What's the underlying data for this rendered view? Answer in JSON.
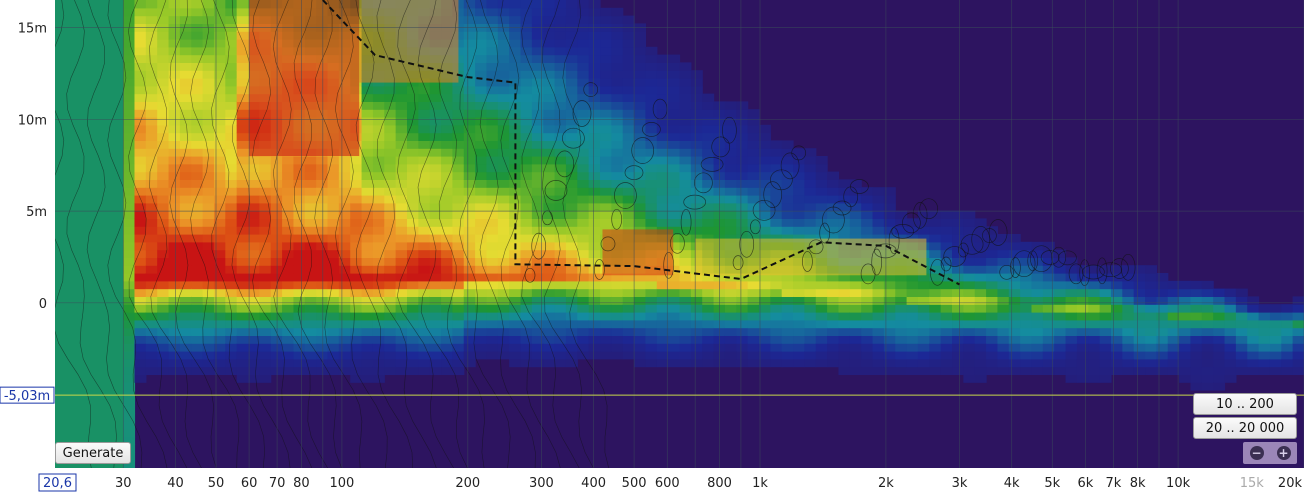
{
  "chart_data": {
    "type": "heatmap",
    "x_scale": "log",
    "xlim": [
      20.6,
      20000
    ],
    "ylim": [
      -9.0,
      16.5
    ],
    "x_ticks": [
      {
        "value": 30,
        "label": "30"
      },
      {
        "value": 40,
        "label": "40"
      },
      {
        "value": 50,
        "label": "50"
      },
      {
        "value": 60,
        "label": "60"
      },
      {
        "value": 70,
        "label": "70"
      },
      {
        "value": 80,
        "label": "80"
      },
      {
        "value": 100,
        "label": "100"
      },
      {
        "value": 200,
        "label": "200"
      },
      {
        "value": 300,
        "label": "300"
      },
      {
        "value": 400,
        "label": "400"
      },
      {
        "value": 500,
        "label": "500"
      },
      {
        "value": 600,
        "label": "600"
      },
      {
        "value": 800,
        "label": "800"
      },
      {
        "value": 1000,
        "label": "1k"
      },
      {
        "value": 2000,
        "label": "2k"
      },
      {
        "value": 3000,
        "label": "3k"
      },
      {
        "value": 4000,
        "label": "4k"
      },
      {
        "value": 5000,
        "label": "5k"
      },
      {
        "value": 6000,
        "label": "6k"
      },
      {
        "value": 7000,
        "label": "7k"
      },
      {
        "value": 8000,
        "label": "8k"
      },
      {
        "value": 10000,
        "label": "10k"
      },
      {
        "value": 15000,
        "label": "15k",
        "muted": true
      },
      {
        "value": 20000,
        "label": "20k"
      }
    ],
    "y_ticks": [
      {
        "value": 15,
        "label": "15m"
      },
      {
        "value": 10,
        "label": "10m"
      },
      {
        "value": 5,
        "label": "5m"
      },
      {
        "value": 0,
        "label": "0"
      }
    ],
    "x_cursor": {
      "value": 20.6,
      "label": "20,6"
    },
    "y_cursor": {
      "value": -5.03,
      "label": "-5,03m"
    },
    "colors": {
      "plot_background": "#2d1460",
      "low_band": "#1e8a2a",
      "grid": "#3a4a5a",
      "cursor_line": "#c8d84a",
      "contour": "#111111"
    },
    "regions": [
      {
        "freq": [
          20.6,
          30
        ],
        "time": [
          -9,
          16.5
        ],
        "value": 0.33
      },
      {
        "freq": [
          60,
          110
        ],
        "time": [
          8,
          16.5
        ],
        "value": 1.0
      },
      {
        "freq": [
          110,
          190
        ],
        "time": [
          12,
          16.5
        ],
        "value": 0.85
      },
      {
        "freq": [
          420,
          620
        ],
        "time": [
          1.5,
          4
        ],
        "value": 0.95
      },
      {
        "freq": [
          700,
          2500
        ],
        "time": [
          1.5,
          3.5
        ],
        "value": 0.75
      }
    ],
    "decay_path": [
      [
        90,
        16.5
      ],
      [
        120,
        13.5
      ],
      [
        200,
        12.3
      ],
      [
        260,
        12.0
      ],
      [
        260,
        2.1
      ],
      [
        500,
        2.0
      ],
      [
        900,
        1.3
      ],
      [
        1400,
        3.3
      ],
      [
        2000,
        3.1
      ],
      [
        3000,
        1.0
      ]
    ]
  },
  "controls": {
    "generate_label": "Generate",
    "preset_a_label": "10 .. 200",
    "preset_b_label": "20 .. 20 000",
    "zoom_out_icon": "−",
    "zoom_in_icon": "+"
  }
}
